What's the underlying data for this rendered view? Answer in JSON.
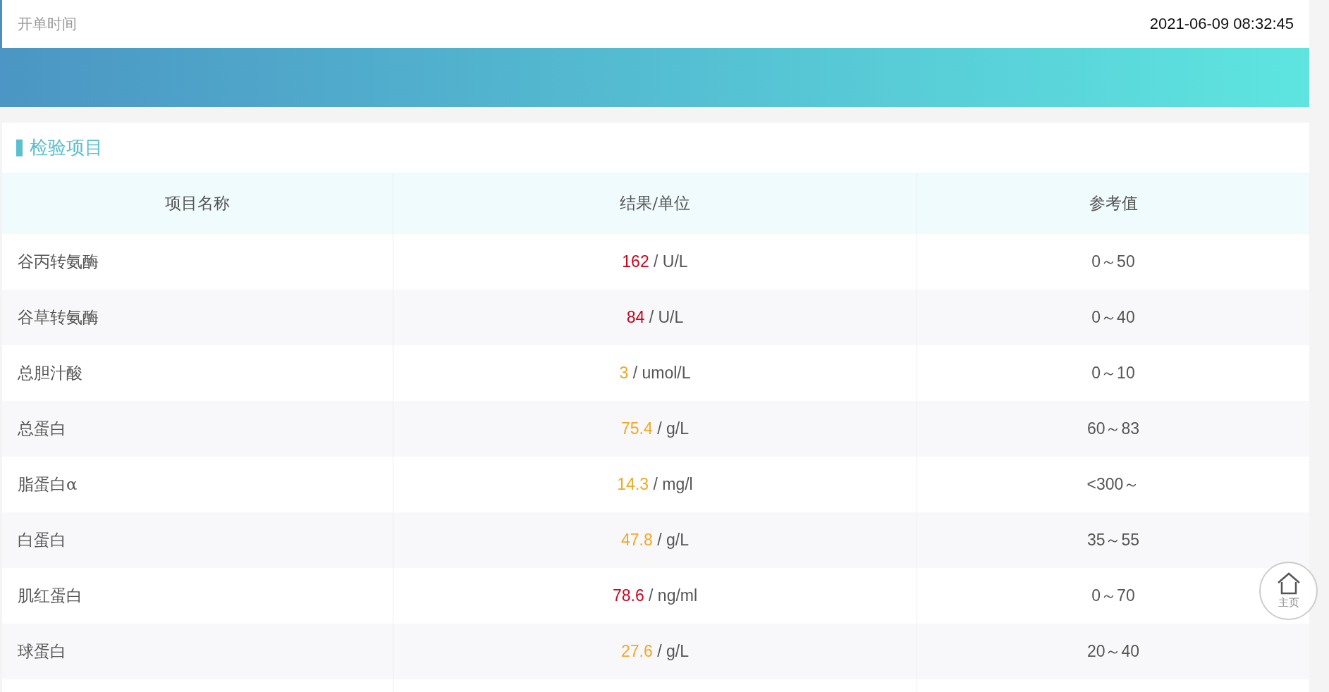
{
  "order_time": {
    "label": "开单时间",
    "value": "2021-06-09 08:32:45"
  },
  "section": {
    "title": "检验项目"
  },
  "table": {
    "columns": [
      "项目名称",
      "结果/单位",
      "参考值"
    ],
    "rows": [
      {
        "name": "谷丙转氨酶",
        "result": "162",
        "unit": "/ U/L",
        "color": "#d0021b",
        "reference": "0～50"
      },
      {
        "name": "谷草转氨酶",
        "result": "84",
        "unit": "/ U/L",
        "color": "#d0021b",
        "reference": "0～40"
      },
      {
        "name": "总胆汁酸",
        "result": "3",
        "unit": "/ umol/L",
        "color": "#f5a623",
        "reference": "0～10"
      },
      {
        "name": "总蛋白",
        "result": "75.4",
        "unit": "/ g/L",
        "color": "#f5a623",
        "reference": "60～83"
      },
      {
        "name": "脂蛋白α",
        "result": "14.3",
        "unit": "/ mg/l",
        "color": "#f5a623",
        "reference": "<300～"
      },
      {
        "name": "白蛋白",
        "result": "47.8",
        "unit": "/ g/L",
        "color": "#f5a623",
        "reference": "35～55"
      },
      {
        "name": "肌红蛋白",
        "result": "78.6",
        "unit": "/ ng/ml",
        "color": "#d0021b",
        "reference": "0～70"
      },
      {
        "name": "球蛋白",
        "result": "27.6",
        "unit": "/ g/L",
        "color": "#f5a623",
        "reference": "20～40"
      }
    ]
  },
  "home_button": {
    "label": "主页"
  }
}
